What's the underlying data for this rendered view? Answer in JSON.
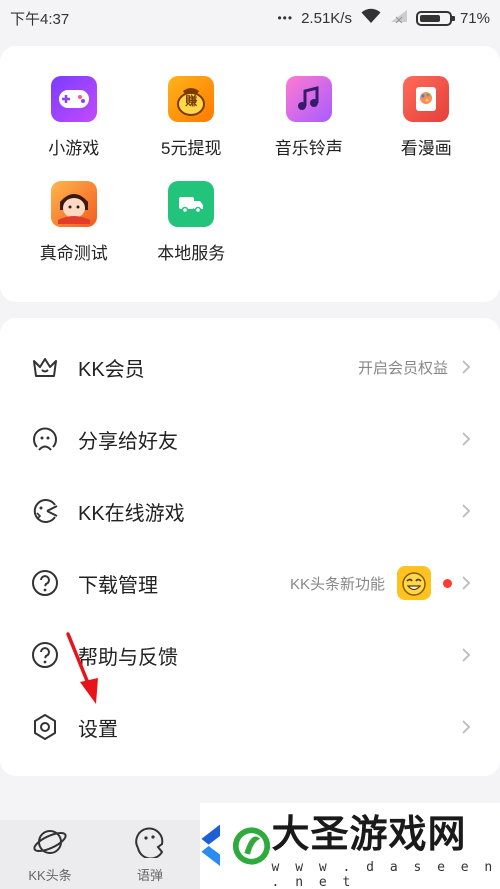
{
  "status_bar": {
    "time": "下午4:37",
    "dots": "•••",
    "speed": "2.51K/s",
    "battery": "71%",
    "battery_level": 0.71
  },
  "apps": [
    {
      "label": "小游戏",
      "icon": "gamepad-icon"
    },
    {
      "label": "5元提现",
      "icon": "money-bag-icon"
    },
    {
      "label": "音乐铃声",
      "icon": "music-note-icon"
    },
    {
      "label": "看漫画",
      "icon": "comic-book-icon"
    },
    {
      "label": "真命测试",
      "icon": "fate-test-icon"
    },
    {
      "label": "本地服务",
      "icon": "delivery-truck-icon"
    }
  ],
  "money_icon_text": "赚",
  "menu": [
    {
      "title": "KK会员",
      "hint": "开启会员权益",
      "icon": "crown-icon"
    },
    {
      "title": "分享给好友",
      "hint": "",
      "icon": "share-face-icon"
    },
    {
      "title": "KK在线游戏",
      "hint": "",
      "icon": "game-face-icon"
    },
    {
      "title": "下载管理",
      "hint": "KK头条新功能",
      "icon": "question-circle-icon"
    },
    {
      "title": "帮助与反馈",
      "hint": "",
      "icon": "question-circle-icon"
    },
    {
      "title": "设置",
      "hint": "",
      "icon": "hexagon-settings-icon"
    }
  ],
  "bottom_nav": [
    {
      "label": "KK头条",
      "icon": "planet-icon"
    },
    {
      "label": "语弹",
      "icon": "chat-face-icon"
    }
  ],
  "watermark": {
    "title": "大圣游戏网",
    "url": "w w w . d a s e e n . n e t"
  },
  "colors": {
    "accent_red": "#ff3b30",
    "badge_yellow": "#ffc21f",
    "local_green": "#22c37a"
  }
}
